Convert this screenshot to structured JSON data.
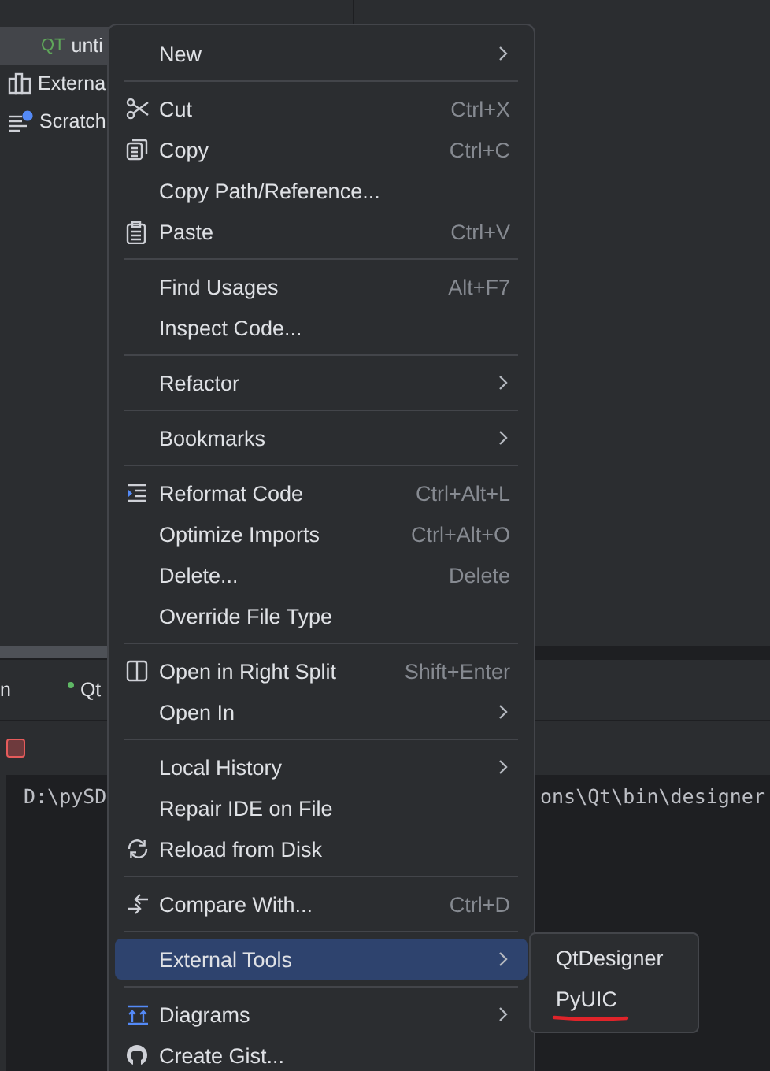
{
  "project_tree": {
    "rows": [
      {
        "label": "unti",
        "icon_text": "QT",
        "selected": true
      },
      {
        "label": "Externa",
        "selected": false
      },
      {
        "label": "Scratch",
        "selected": false
      }
    ]
  },
  "tool_window": {
    "tabs": [
      {
        "label": "n",
        "running": false
      },
      {
        "label": "Qt",
        "running": true
      }
    ]
  },
  "console": {
    "line_start": "D:\\pySD",
    "line_end": "ons\\Qt\\bin\\designer"
  },
  "context_menu": {
    "items": [
      {
        "kind": "item",
        "label": "New",
        "submenu": true,
        "selected": false
      },
      {
        "kind": "separator"
      },
      {
        "kind": "item",
        "label": "Cut",
        "shortcut": "Ctrl+X",
        "selected": false
      },
      {
        "kind": "item",
        "label": "Copy",
        "shortcut": "Ctrl+C",
        "selected": false
      },
      {
        "kind": "item",
        "label": "Copy Path/Reference...",
        "selected": false
      },
      {
        "kind": "item",
        "label": "Paste",
        "shortcut": "Ctrl+V",
        "selected": false
      },
      {
        "kind": "separator"
      },
      {
        "kind": "item",
        "label": "Find Usages",
        "shortcut": "Alt+F7",
        "selected": false
      },
      {
        "kind": "item",
        "label": "Inspect Code...",
        "selected": false
      },
      {
        "kind": "separator"
      },
      {
        "kind": "item",
        "label": "Refactor",
        "submenu": true,
        "selected": false
      },
      {
        "kind": "separator"
      },
      {
        "kind": "item",
        "label": "Bookmarks",
        "submenu": true,
        "selected": false
      },
      {
        "kind": "separator"
      },
      {
        "kind": "item",
        "label": "Reformat Code",
        "shortcut": "Ctrl+Alt+L",
        "selected": false
      },
      {
        "kind": "item",
        "label": "Optimize Imports",
        "shortcut": "Ctrl+Alt+O",
        "selected": false
      },
      {
        "kind": "item",
        "label": "Delete...",
        "shortcut": "Delete",
        "selected": false
      },
      {
        "kind": "item",
        "label": "Override File Type",
        "selected": false
      },
      {
        "kind": "separator"
      },
      {
        "kind": "item",
        "label": "Open in Right Split",
        "shortcut": "Shift+Enter",
        "selected": false
      },
      {
        "kind": "item",
        "label": "Open In",
        "submenu": true,
        "selected": false
      },
      {
        "kind": "separator"
      },
      {
        "kind": "item",
        "label": "Local History",
        "submenu": true,
        "selected": false
      },
      {
        "kind": "item",
        "label": "Repair IDE on File",
        "selected": false
      },
      {
        "kind": "item",
        "label": "Reload from Disk",
        "selected": false
      },
      {
        "kind": "separator"
      },
      {
        "kind": "item",
        "label": "Compare With...",
        "shortcut": "Ctrl+D",
        "selected": false
      },
      {
        "kind": "separator"
      },
      {
        "kind": "item",
        "label": "External Tools",
        "submenu": true,
        "selected": true
      },
      {
        "kind": "separator"
      },
      {
        "kind": "item",
        "label": "Diagrams",
        "submenu": true,
        "selected": false
      },
      {
        "kind": "item",
        "label": "Create Gist...",
        "selected": false
      }
    ]
  },
  "submenu": {
    "items": [
      {
        "label": "QtDesigner",
        "annotated": false
      },
      {
        "label": "PyUIC",
        "annotated": true
      }
    ]
  }
}
